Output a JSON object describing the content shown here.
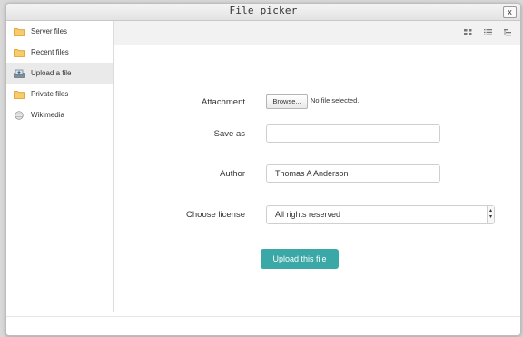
{
  "dialog": {
    "title": "File picker",
    "close_label": "x"
  },
  "sidebar": {
    "items": [
      {
        "label": "Server files",
        "icon": "folder-icon",
        "active": false
      },
      {
        "label": "Recent files",
        "icon": "folder-icon",
        "active": false
      },
      {
        "label": "Upload a file",
        "icon": "upload-icon",
        "active": true
      },
      {
        "label": "Private files",
        "icon": "folder-icon",
        "active": false
      },
      {
        "label": "Wikimedia",
        "icon": "wikimedia-icon",
        "active": false
      }
    ]
  },
  "toolbar": {
    "view_icons": [
      "grid-view-icon",
      "list-view-icon",
      "tree-view-icon"
    ]
  },
  "form": {
    "attachment_label": "Attachment",
    "browse_label": "Browse...",
    "no_file_text": "No file selected.",
    "save_as_label": "Save as",
    "save_as_value": "",
    "author_label": "Author",
    "author_value": "Thomas A Anderson",
    "license_label": "Choose license",
    "license_value": "All rights reserved",
    "upload_label": "Upload this file"
  },
  "colors": {
    "accent": "#3aa8a6",
    "folder": "#f3b73f",
    "active_bg": "#eaeaea"
  }
}
